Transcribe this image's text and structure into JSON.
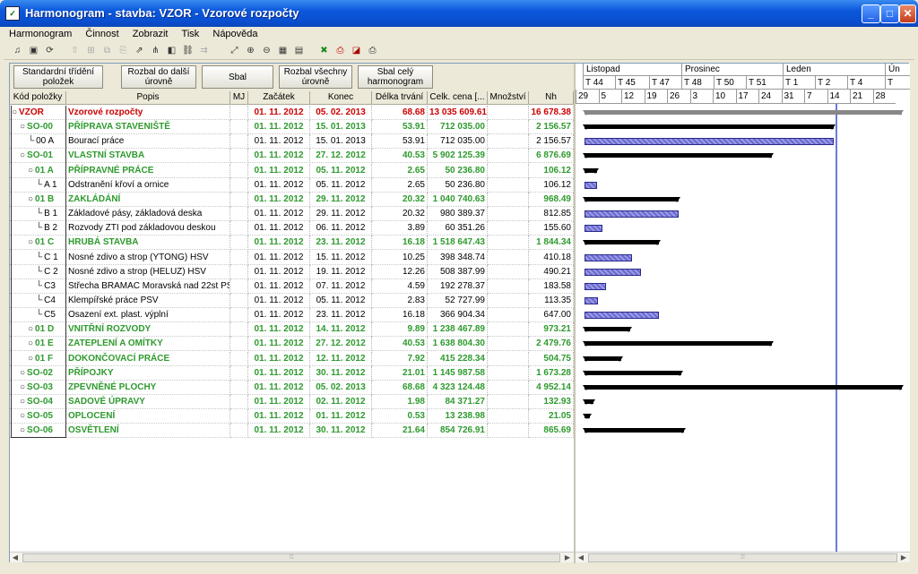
{
  "window": {
    "title": "Harmonogram - stavba: VZOR - Vzorové rozpočty"
  },
  "menu": [
    "Harmonogram",
    "Činnost",
    "Zobrazit",
    "Tisk",
    "Nápověda"
  ],
  "buttons": {
    "standard": "Standardní třídění položek",
    "expand_next": "Rozbal do další úrovně",
    "collapse": "Sbal",
    "expand_all": "Rozbal všechny úrovně",
    "collapse_all": "Sbal celý harmonogram"
  },
  "columns": {
    "code": "Kód položky",
    "desc": "Popis",
    "mj": "MJ",
    "start": "Začátek",
    "end": "Konec",
    "duration": "Délka trvání",
    "price": "Celk. cena [...",
    "qty": "Množství",
    "nh": "Nh"
  },
  "rows": [
    {
      "code": "VZOR",
      "desc": "Vzorové rozpočty",
      "start": "01. 11. 2012",
      "end": "05. 02. 2013",
      "dur": "68.68",
      "price": "13 035 609.61",
      "nh": "16 678.38",
      "style": "red",
      "lvl": 0,
      "s": 0,
      "d": 68.68,
      "kind": "grey"
    },
    {
      "code": "SO-00",
      "desc": "PŘÍPRAVA STAVENIŠTĚ",
      "start": "01. 11. 2012",
      "end": "15. 01. 2013",
      "dur": "53.91",
      "price": "712 035.00",
      "nh": "2 156.57",
      "style": "grn",
      "lvl": 1,
      "s": 0,
      "d": 53.91,
      "kind": "sum"
    },
    {
      "code": "00 A",
      "desc": "Bourací práce",
      "start": "01. 11. 2012",
      "end": "15. 01. 2013",
      "dur": "53.91",
      "price": "712 035.00",
      "nh": "2 156.57",
      "style": "blk",
      "lvl": 2,
      "s": 0,
      "d": 53.91,
      "kind": "task"
    },
    {
      "code": "SO-01",
      "desc": "VLASTNÍ STAVBA",
      "start": "01. 11. 2012",
      "end": "27. 12. 2012",
      "dur": "40.53",
      "price": "5 902 125.39",
      "nh": "6 876.69",
      "style": "grn",
      "lvl": 1,
      "s": 0,
      "d": 40.53,
      "kind": "sum"
    },
    {
      "code": "01 A",
      "desc": "PŘÍPRAVNÉ PRÁCE",
      "start": "01. 11. 2012",
      "end": "05. 11. 2012",
      "dur": "2.65",
      "price": "50 236.80",
      "nh": "106.12",
      "style": "grn",
      "lvl": 2,
      "s": 0,
      "d": 2.65,
      "kind": "sum"
    },
    {
      "code": "A 1",
      "desc": "Odstranění křoví a ornice",
      "start": "01. 11. 2012",
      "end": "05. 11. 2012",
      "dur": "2.65",
      "price": "50 236.80",
      "nh": "106.12",
      "style": "blk",
      "lvl": 3,
      "s": 0,
      "d": 2.65,
      "kind": "task"
    },
    {
      "code": "01 B",
      "desc": "ZAKLÁDÁNÍ",
      "start": "01. 11. 2012",
      "end": "29. 11. 2012",
      "dur": "20.32",
      "price": "1 040 740.63",
      "nh": "968.49",
      "style": "grn",
      "lvl": 2,
      "s": 0,
      "d": 20.32,
      "kind": "sum"
    },
    {
      "code": "B 1",
      "desc": "Základové pásy, základová deska",
      "start": "01. 11. 2012",
      "end": "29. 11. 2012",
      "dur": "20.32",
      "price": "980 389.37",
      "nh": "812.85",
      "style": "blk",
      "lvl": 3,
      "s": 0,
      "d": 20.32,
      "kind": "task"
    },
    {
      "code": "B 2",
      "desc": "Rozvody ZTI pod základovou deskou",
      "start": "01. 11. 2012",
      "end": "06. 11. 2012",
      "dur": "3.89",
      "price": "60 351.26",
      "nh": "155.60",
      "style": "blk",
      "lvl": 3,
      "s": 0,
      "d": 3.89,
      "kind": "task"
    },
    {
      "code": "01 C",
      "desc": "HRUBÁ STAVBA",
      "start": "01. 11. 2012",
      "end": "23. 11. 2012",
      "dur": "16.18",
      "price": "1 518 647.43",
      "nh": "1 844.34",
      "style": "grn",
      "lvl": 2,
      "s": 0,
      "d": 16.18,
      "kind": "sum"
    },
    {
      "code": "C 1",
      "desc": "Nosné zdivo a strop  (YTONG) HSV",
      "start": "01. 11. 2012",
      "end": "15. 11. 2012",
      "dur": "10.25",
      "price": "398 348.74",
      "nh": "410.18",
      "style": "blk",
      "lvl": 3,
      "s": 0,
      "d": 10.25,
      "kind": "task"
    },
    {
      "code": "C 2",
      "desc": "Nosné zdivo a strop (HELUZ) HSV",
      "start": "01. 11. 2012",
      "end": "19. 11. 2012",
      "dur": "12.26",
      "price": "508 387.99",
      "nh": "490.21",
      "style": "blk",
      "lvl": 3,
      "s": 0,
      "d": 12.26,
      "kind": "task"
    },
    {
      "code": "C3",
      "desc": "Střecha BRAMAC Moravská nad 22st  PSV",
      "start": "01. 11. 2012",
      "end": "07. 11. 2012",
      "dur": "4.59",
      "price": "192 278.37",
      "nh": "183.58",
      "style": "blk",
      "lvl": 3,
      "s": 0,
      "d": 4.59,
      "kind": "task"
    },
    {
      "code": "C4",
      "desc": "Klempířské práce PSV",
      "start": "01. 11. 2012",
      "end": "05. 11. 2012",
      "dur": "2.83",
      "price": "52 727.99",
      "nh": "113.35",
      "style": "blk",
      "lvl": 3,
      "s": 0,
      "d": 2.83,
      "kind": "task"
    },
    {
      "code": "C5",
      "desc": "Osazení ext. plast. výplní",
      "start": "01. 11. 2012",
      "end": "23. 11. 2012",
      "dur": "16.18",
      "price": "366 904.34",
      "nh": "647.00",
      "style": "blk",
      "lvl": 3,
      "s": 0,
      "d": 16.18,
      "kind": "task"
    },
    {
      "code": "01 D",
      "desc": "VNITŘNÍ ROZVODY",
      "start": "01. 11. 2012",
      "end": "14. 11. 2012",
      "dur": "9.89",
      "price": "1 238 467.89",
      "nh": "973.21",
      "style": "grn",
      "lvl": 2,
      "s": 0,
      "d": 9.89,
      "kind": "sum"
    },
    {
      "code": "01 E",
      "desc": "ZATEPLENÍ A OMÍTKY",
      "start": "01. 11. 2012",
      "end": "27. 12. 2012",
      "dur": "40.53",
      "price": "1 638 804.30",
      "nh": "2 479.76",
      "style": "grn",
      "lvl": 2,
      "s": 0,
      "d": 40.53,
      "kind": "sum"
    },
    {
      "code": "01 F",
      "desc": "DOKONČOVACÍ PRÁCE",
      "start": "01. 11. 2012",
      "end": "12. 11. 2012",
      "dur": "7.92",
      "price": "415 228.34",
      "nh": "504.75",
      "style": "grn",
      "lvl": 2,
      "s": 0,
      "d": 7.92,
      "kind": "sum"
    },
    {
      "code": "SO-02",
      "desc": "PŘÍPOJKY",
      "start": "01. 11. 2012",
      "end": "30. 11. 2012",
      "dur": "21.01",
      "price": "1 145 987.58",
      "nh": "1 673.28",
      "style": "grn",
      "lvl": 1,
      "s": 0,
      "d": 21.01,
      "kind": "sum"
    },
    {
      "code": "SO-03",
      "desc": "ZPEVNĚNÉ PLOCHY",
      "start": "01. 11. 2012",
      "end": "05. 02. 2013",
      "dur": "68.68",
      "price": "4 323 124.48",
      "nh": "4 952.14",
      "style": "grn",
      "lvl": 1,
      "s": 0,
      "d": 68.68,
      "kind": "sum"
    },
    {
      "code": "SO-04",
      "desc": "SADOVÉ ÚPRAVY",
      "start": "01. 11. 2012",
      "end": "02. 11. 2012",
      "dur": "1.98",
      "price": "84 371.27",
      "nh": "132.93",
      "style": "grn",
      "lvl": 1,
      "s": 0,
      "d": 1.98,
      "kind": "sum"
    },
    {
      "code": "SO-05",
      "desc": "OPLOCENÍ",
      "start": "01. 11. 2012",
      "end": "01. 11. 2012",
      "dur": "0.53",
      "price": "13 238.98",
      "nh": "21.05",
      "style": "grn",
      "lvl": 1,
      "s": 0,
      "d": 0.53,
      "kind": "sum"
    },
    {
      "code": "SO-06",
      "desc": "OSVĚTLENÍ",
      "start": "01. 11. 2012",
      "end": "30. 11. 2012",
      "dur": "21.64",
      "price": "854 726.91",
      "nh": "865.69",
      "style": "grn",
      "lvl": 1,
      "s": 0,
      "d": 21.64,
      "kind": "sum"
    }
  ],
  "gantt": {
    "months": [
      "Listopad",
      "Prosinec",
      "Leden",
      "Ún"
    ],
    "weeks": [
      "T 44",
      "T 45",
      "T 47",
      "T 48",
      "T 50",
      "T 51",
      "T 1",
      "T 2",
      "T 4",
      "T"
    ],
    "days": [
      "29",
      "5",
      "12",
      "19",
      "26",
      "3",
      "10",
      "17",
      "24",
      "31",
      "7",
      "14",
      "21",
      "28"
    ]
  }
}
